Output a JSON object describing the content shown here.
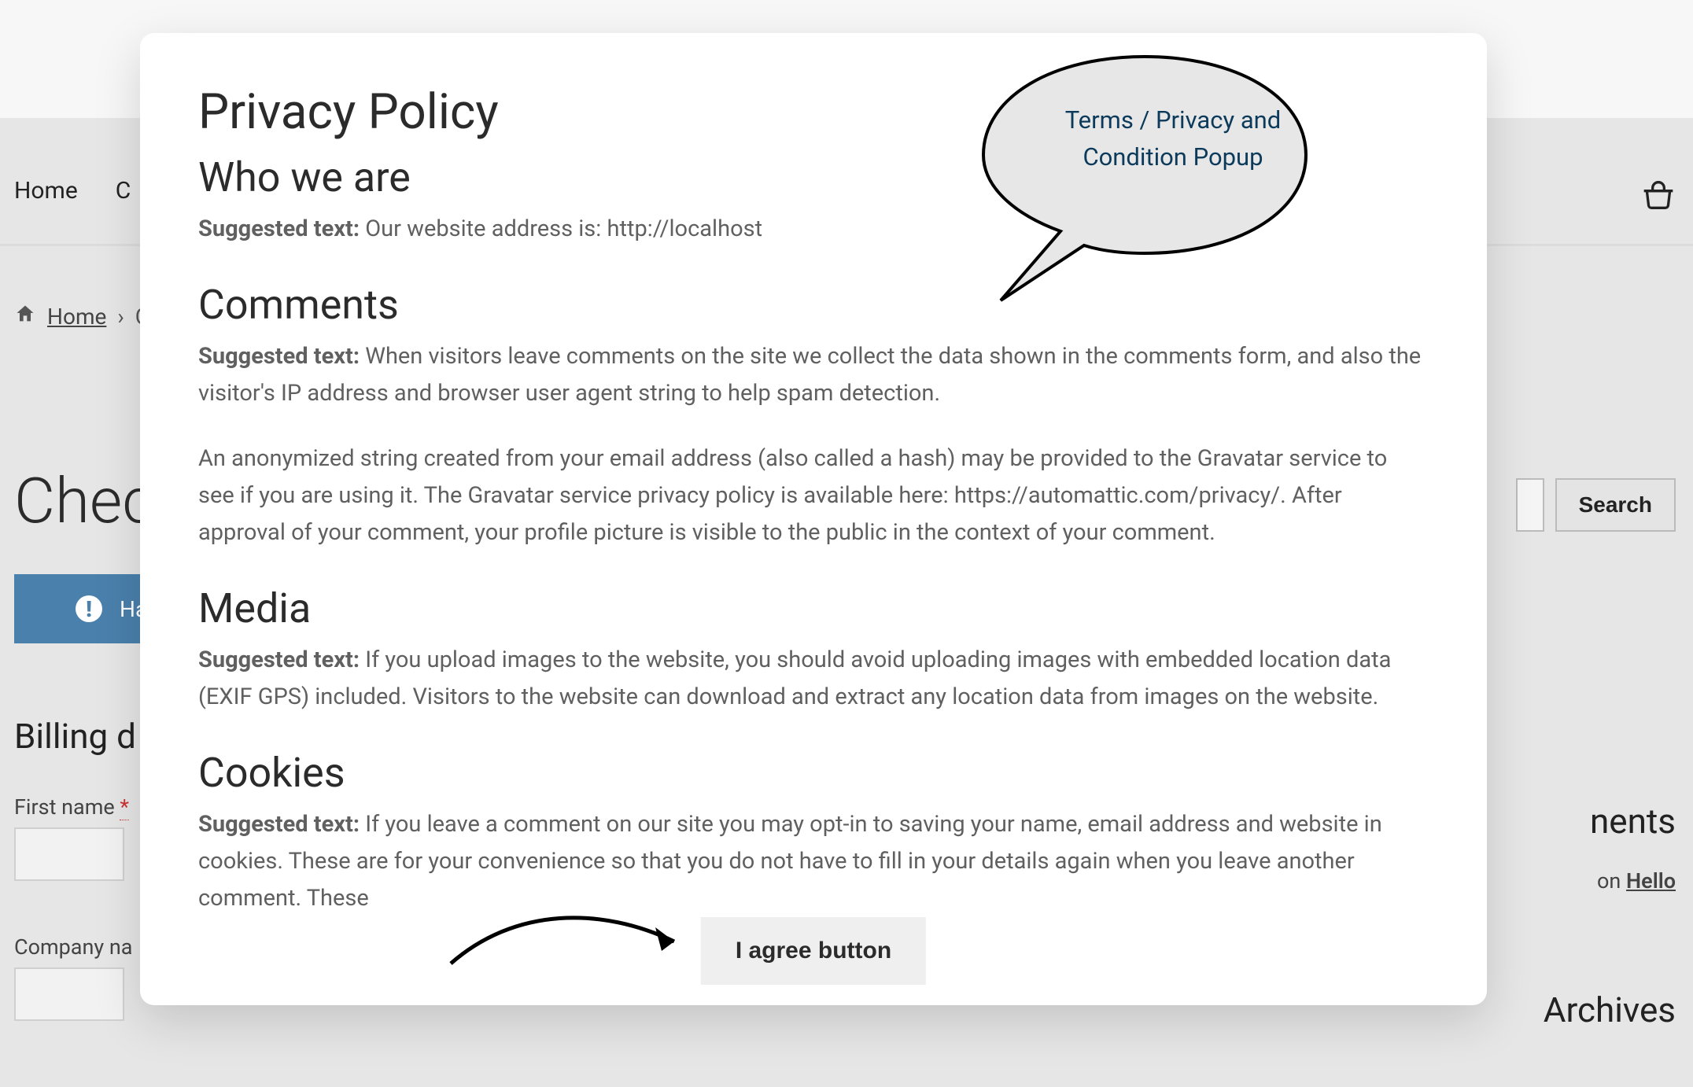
{
  "bg": {
    "nav": {
      "home": "Home",
      "c_partial": "C"
    },
    "breadcrumb": {
      "home": "Home",
      "sep": "›",
      "c_partial": "C"
    },
    "page_title_partial": "Chec",
    "search_button": "Search",
    "coupon_partial": "Ha",
    "billing_heading_partial": "Billing d",
    "first_name_label": "First name",
    "required_marker": "*",
    "company_label_partial": "Company na",
    "sidebar": {
      "comments_heading_partial": "nents",
      "on_text": "on ",
      "hello_link": "Hello",
      "archives_heading": "Archives"
    }
  },
  "modal": {
    "title": "Privacy Policy",
    "who_heading": "Who we are",
    "suggested_label": "Suggested text: ",
    "who_text": "Our website address is: http://localhost",
    "comments_heading": "Comments",
    "comments_text_1": "When visitors leave comments on the site we collect the data shown in the comments form, and also the visitor's IP address and browser user agent string to help spam detection.",
    "comments_text_2": "An anonymized string created from your email address (also called a hash) may be provided to the Gravatar service to see if you are using it. The Gravatar service privacy policy is available here: https://automattic.com/privacy/. After approval of your comment, your profile picture is visible to the public in the context of your comment.",
    "media_heading": "Media",
    "media_text": "If you upload images to the website, you should avoid uploading images with embedded location data (EXIF GPS) included. Visitors to the website can download and extract any location data from images on the website.",
    "cookies_heading": "Cookies",
    "cookies_text": "If you leave a comment on our site you may opt-in to saving your name, email address and website in cookies. These are for your convenience so that you do not have to fill in your details again when you leave another comment. These",
    "agree_button": "I agree button"
  },
  "annotations": {
    "callout_line1": "Terms / Privacy and",
    "callout_line2": "Condition Popup"
  }
}
